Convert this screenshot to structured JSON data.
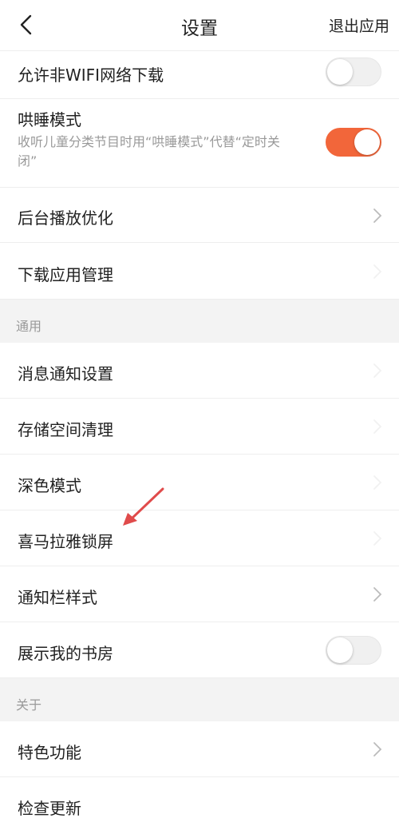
{
  "header": {
    "title": "设置",
    "exit_label": "退出应用"
  },
  "rows": {
    "wifi_download": {
      "label": "允许非WIFI网络下载",
      "toggle": "off"
    },
    "lull_mode": {
      "label": "哄睡模式",
      "desc": "收听儿童分类节目时用“哄睡模式”代替“定时关闭”",
      "toggle": "on"
    },
    "bg_play": {
      "label": "后台播放优化"
    },
    "download_manage": {
      "label": "下载应用管理"
    },
    "notify_settings": {
      "label": "消息通知设置"
    },
    "storage_clean": {
      "label": "存储空间清理"
    },
    "dark_mode": {
      "label": "深色模式"
    },
    "lock_screen": {
      "label": "喜马拉雅锁屏"
    },
    "notify_style": {
      "label": "通知栏样式"
    },
    "show_study": {
      "label": "展示我的书房",
      "toggle": "off"
    },
    "features": {
      "label": "特色功能"
    },
    "check_update": {
      "label": "检查更新"
    }
  },
  "sections": {
    "general": "通用",
    "about": "关于"
  },
  "colors": {
    "accent": "#f2663a",
    "section_bg": "#f3f3f3",
    "secondary_text": "#999999"
  }
}
